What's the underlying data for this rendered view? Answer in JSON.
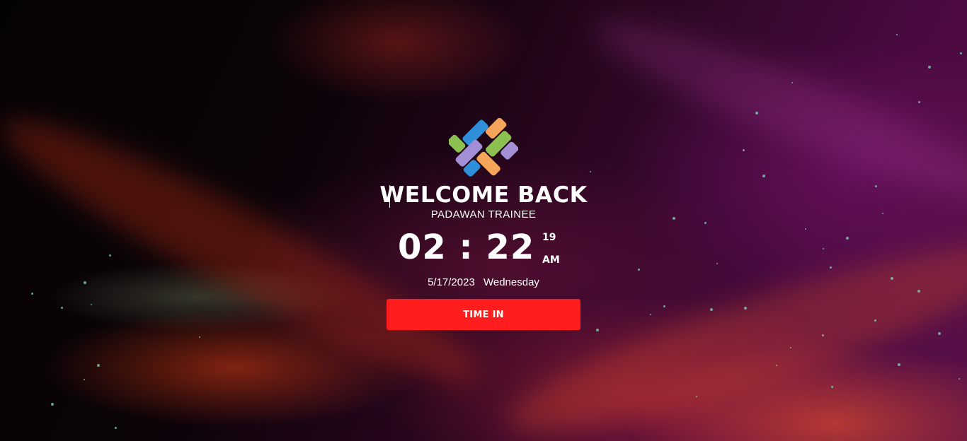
{
  "welcome": {
    "title": "WELCOME BACK",
    "subtitle": "PADAWAN TRAINEE"
  },
  "clock": {
    "time": "02 : 22",
    "seconds": "19",
    "ampm": "AM"
  },
  "date": {
    "date": "5/17/2023",
    "weekday": "Wednesday"
  },
  "actions": {
    "time_in_label": "TIME IN"
  },
  "colors": {
    "button": "#ff1d1d",
    "logo_orange": "#f5a55a",
    "logo_green": "#8cc152",
    "logo_blue": "#2f8fd8",
    "logo_purple": "#a38fd6"
  }
}
